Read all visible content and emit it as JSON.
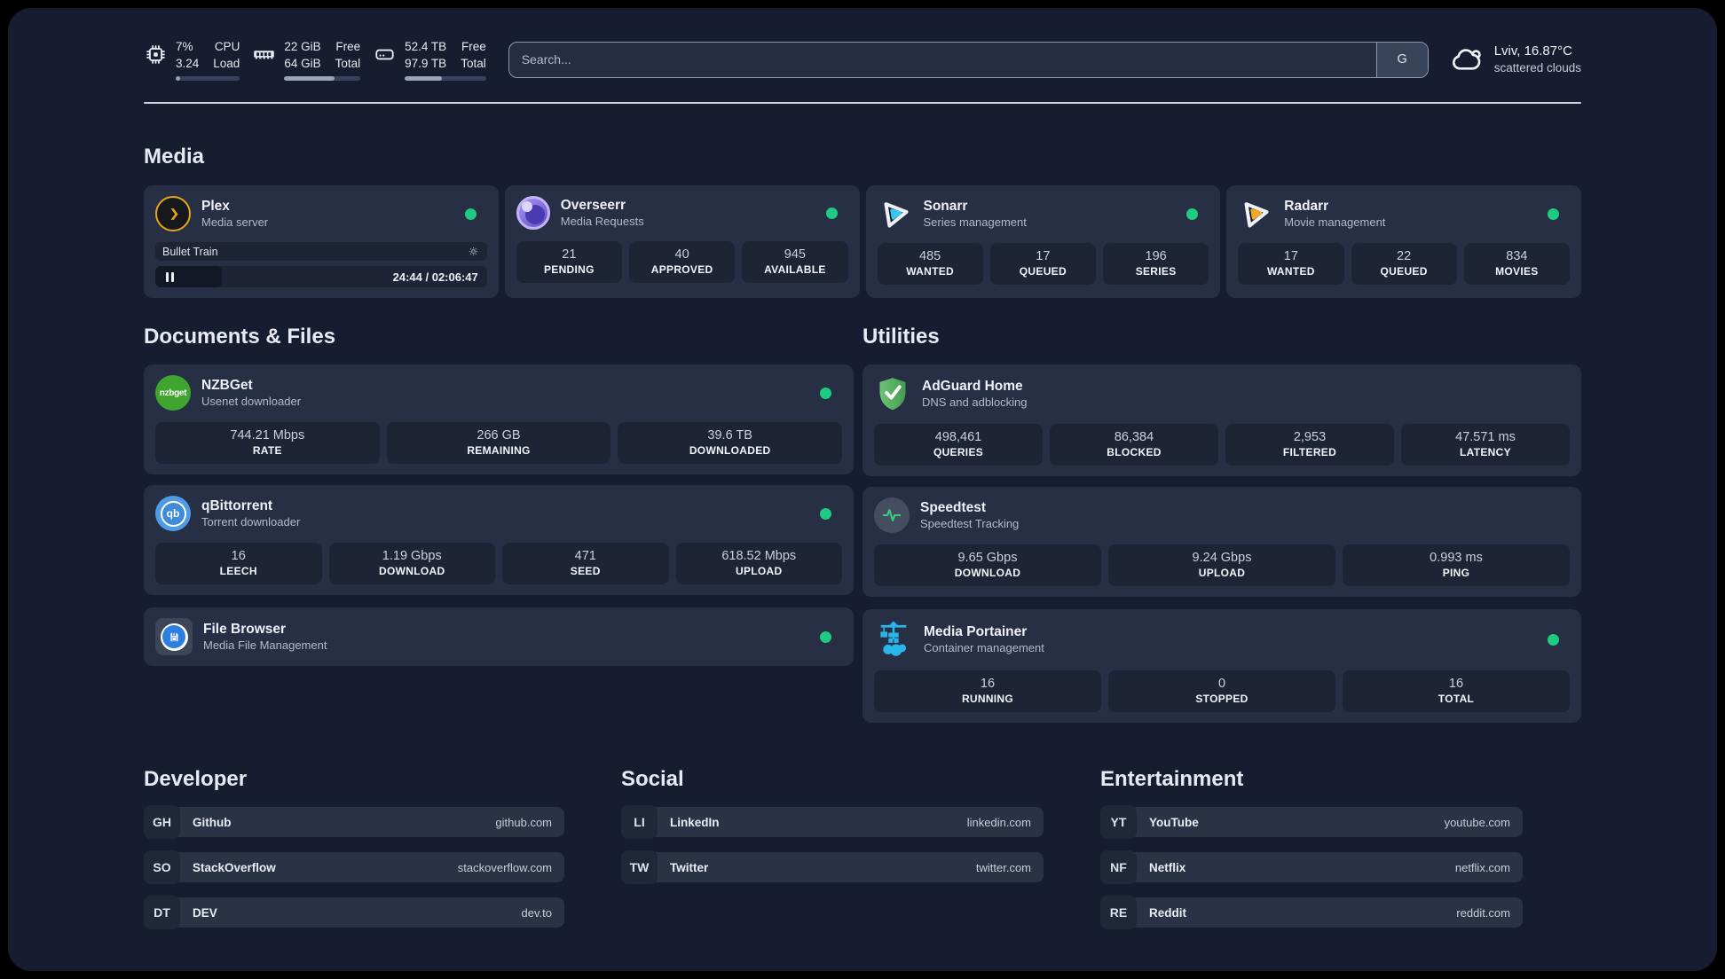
{
  "colors": {
    "status_online": "#1fcb81",
    "panel_background": "#171d30",
    "card_background": "#272f45",
    "plex_amber": "#e7a517",
    "sonarr_cyan": "#36c6f4",
    "radarr_amber": "#f7a823",
    "nzbget_green": "#3fa52e",
    "qbittorrent_blue": "#4f9be8",
    "filebrowser_blue": "#2f7fe0",
    "adguard_green": "#52b055",
    "speedtest_green": "#35d07f",
    "portainer_blue": "#29b6ea"
  },
  "header": {
    "cpu": {
      "usage": "7%",
      "load": "3.24",
      "label_top": "CPU",
      "label_bottom": "Load",
      "progress_pct": 7
    },
    "memory": {
      "free": "22 GiB",
      "total": "64 GiB",
      "label_top": "Free",
      "label_bottom": "Total",
      "progress_pct": 66
    },
    "disk": {
      "free": "52.4 TB",
      "total": "97.9 TB",
      "label_top": "Free",
      "label_bottom": "Total",
      "progress_pct": 46
    },
    "search": {
      "placeholder": "Search...",
      "engine_button": "G"
    },
    "weather": {
      "location": "Lviv, 16.87°C",
      "condition": "scattered clouds"
    }
  },
  "media": {
    "title": "Media",
    "plex": {
      "name": "Plex",
      "description": "Media server",
      "now_playing": {
        "title": "Bullet Train",
        "time_display": "24:44 / 02:06:47",
        "progress_pct": 20
      }
    },
    "overseerr": {
      "name": "Overseerr",
      "description": "Media Requests",
      "stats": [
        {
          "value": "21",
          "label": "PENDING"
        },
        {
          "value": "40",
          "label": "APPROVED"
        },
        {
          "value": "945",
          "label": "AVAILABLE"
        }
      ]
    },
    "sonarr": {
      "name": "Sonarr",
      "description": "Series management",
      "stats": [
        {
          "value": "485",
          "label": "WANTED"
        },
        {
          "value": "17",
          "label": "QUEUED"
        },
        {
          "value": "196",
          "label": "SERIES"
        }
      ]
    },
    "radarr": {
      "name": "Radarr",
      "description": "Movie management",
      "stats": [
        {
          "value": "17",
          "label": "WANTED"
        },
        {
          "value": "22",
          "label": "QUEUED"
        },
        {
          "value": "834",
          "label": "MOVIES"
        }
      ]
    }
  },
  "documents": {
    "title": "Documents & Files",
    "nzbget": {
      "name": "NZBGet",
      "description": "Usenet downloader",
      "logo_text": "nzbget",
      "stats": [
        {
          "value": "744.21 Mbps",
          "label": "RATE"
        },
        {
          "value": "266 GB",
          "label": "REMAINING"
        },
        {
          "value": "39.6 TB",
          "label": "DOWNLOADED"
        }
      ]
    },
    "qbittorrent": {
      "name": "qBittorrent",
      "description": "Torrent downloader",
      "logo_text": "qb",
      "stats": [
        {
          "value": "16",
          "label": "LEECH"
        },
        {
          "value": "1.19 Gbps",
          "label": "DOWNLOAD"
        },
        {
          "value": "471",
          "label": "SEED"
        },
        {
          "value": "618.52 Mbps",
          "label": "UPLOAD"
        }
      ]
    },
    "filebrowser": {
      "name": "File Browser",
      "description": "Media File Management"
    }
  },
  "utilities": {
    "title": "Utilities",
    "adguard": {
      "name": "AdGuard Home",
      "description": "DNS and adblocking",
      "stats": [
        {
          "value": "498,461",
          "label": "QUERIES"
        },
        {
          "value": "86,384",
          "label": "BLOCKED"
        },
        {
          "value": "2,953",
          "label": "FILTERED"
        },
        {
          "value": "47.571 ms",
          "label": "LATENCY"
        }
      ]
    },
    "speedtest": {
      "name": "Speedtest",
      "description": "Speedtest Tracking",
      "stats": [
        {
          "value": "9.65 Gbps",
          "label": "DOWNLOAD"
        },
        {
          "value": "9.24 Gbps",
          "label": "UPLOAD"
        },
        {
          "value": "0.993 ms",
          "label": "PING"
        }
      ]
    },
    "portainer": {
      "name": "Media Portainer",
      "description": "Container management",
      "stats": [
        {
          "value": "16",
          "label": "RUNNING"
        },
        {
          "value": "0",
          "label": "STOPPED"
        },
        {
          "value": "16",
          "label": "TOTAL"
        }
      ]
    }
  },
  "bookmarks": [
    {
      "title": "Developer",
      "links": [
        {
          "abbr": "GH",
          "name": "Github",
          "url": "github.com"
        },
        {
          "abbr": "SO",
          "name": "StackOverflow",
          "url": "stackoverflow.com"
        },
        {
          "abbr": "DT",
          "name": "DEV",
          "url": "dev.to"
        }
      ]
    },
    {
      "title": "Social",
      "links": [
        {
          "abbr": "LI",
          "name": "LinkedIn",
          "url": "linkedin.com"
        },
        {
          "abbr": "TW",
          "name": "Twitter",
          "url": "twitter.com"
        }
      ]
    },
    {
      "title": "Entertainment",
      "links": [
        {
          "abbr": "YT",
          "name": "YouTube",
          "url": "youtube.com"
        },
        {
          "abbr": "NF",
          "name": "Netflix",
          "url": "netflix.com"
        },
        {
          "abbr": "RE",
          "name": "Reddit",
          "url": "reddit.com"
        }
      ]
    }
  ]
}
